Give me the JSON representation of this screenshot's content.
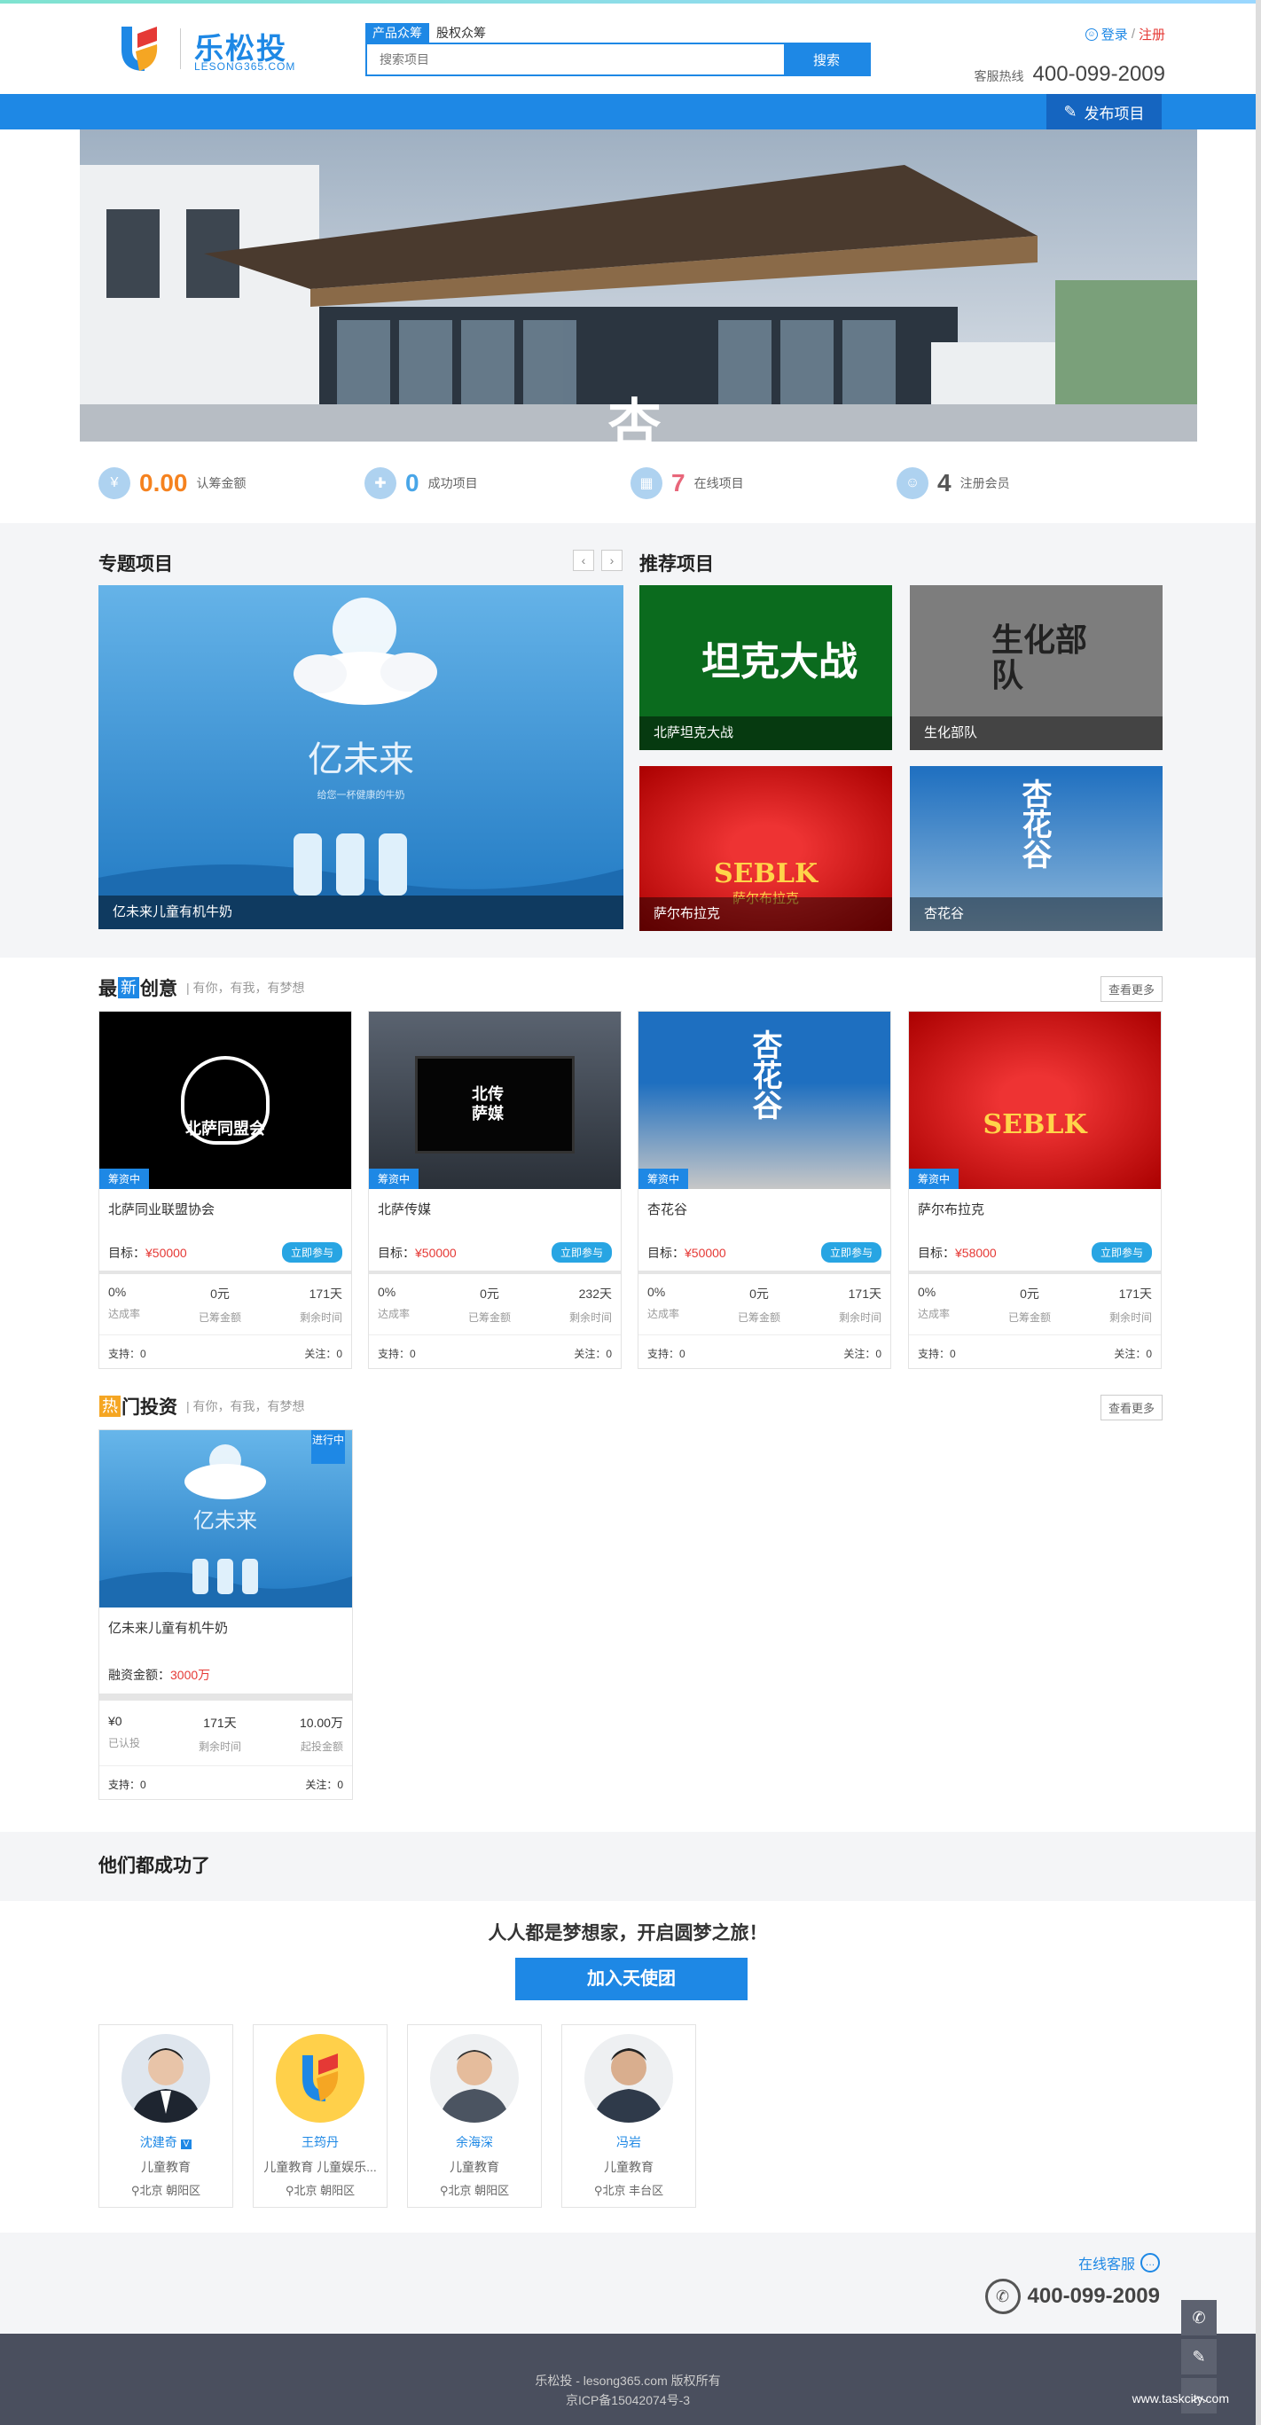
{
  "header": {
    "logo_cn": "乐松投",
    "logo_en": "LESONG365.COM",
    "search_tabs": [
      "产品众筹",
      "股权众筹"
    ],
    "search_placeholder": "搜索项目",
    "search_button": "搜索",
    "login": "登录",
    "divider": "/",
    "register": "注册",
    "hotline_label": "客服热线",
    "hotline_number": "400-099-2009"
  },
  "nav": {
    "publish": "发布项目"
  },
  "banner": {
    "title_art": "杏花谷"
  },
  "stats": [
    {
      "icon": "money-icon",
      "value": "0.00",
      "label": "认筹金额",
      "color": "#f5821f"
    },
    {
      "icon": "success-icon",
      "value": "0",
      "label": "成功项目",
      "color": "#49a6e8"
    },
    {
      "icon": "online-icon",
      "value": "7",
      "label": "在线项目",
      "color": "#e8667a"
    },
    {
      "icon": "member-icon",
      "value": "4",
      "label": "注册会员",
      "color": "#555555"
    }
  ],
  "featured": {
    "left_title": "专题项目",
    "right_title": "推荐项目",
    "big": {
      "caption": "亿未来儿童有机牛奶",
      "art_title": "亿未来",
      "art_sub": "给您一杯健康的牛奶"
    },
    "tiles": [
      {
        "caption": "北萨坦克大战",
        "art": "坦克大战"
      },
      {
        "caption": "生化部队",
        "art": "生化部队"
      },
      {
        "caption": "萨尔布拉克",
        "art": "SEBLK"
      },
      {
        "caption": "杏花谷",
        "art": "杏花谷"
      }
    ],
    "tile_sub": "萨尔布拉克"
  },
  "newest": {
    "title_pre": "最",
    "title_hl": "新",
    "title_post": "创意",
    "subtitle": "| 有你，有我，有梦想",
    "more": "查看更多",
    "cards": [
      {
        "badge": "筹资中",
        "name": "北萨同业联盟协会",
        "goal_label": "目标：",
        "goal": "¥50000",
        "join": "立即参与",
        "rate": "0%",
        "rate_l": "达成率",
        "raised": "0元",
        "raised_l": "已筹金额",
        "days": "171天",
        "days_l": "剩余时间",
        "support": "支持：0",
        "follow": "关注：0",
        "art": "北萨同盟会"
      },
      {
        "badge": "筹资中",
        "name": "北萨传媒",
        "goal_label": "目标：",
        "goal": "¥50000",
        "join": "立即参与",
        "rate": "0%",
        "rate_l": "达成率",
        "raised": "0元",
        "raised_l": "已筹金额",
        "days": "232天",
        "days_l": "剩余时间",
        "support": "支持：0",
        "follow": "关注：0",
        "art": "北传萨媒"
      },
      {
        "badge": "筹资中",
        "name": "杏花谷",
        "goal_label": "目标：",
        "goal": "¥50000",
        "join": "立即参与",
        "rate": "0%",
        "rate_l": "达成率",
        "raised": "0元",
        "raised_l": "已筹金额",
        "days": "171天",
        "days_l": "剩余时间",
        "support": "支持：0",
        "follow": "关注：0",
        "art": "杏花谷"
      },
      {
        "badge": "筹资中",
        "name": "萨尔布拉克",
        "goal_label": "目标：",
        "goal": "¥58000",
        "join": "立即参与",
        "rate": "0%",
        "rate_l": "达成率",
        "raised": "0元",
        "raised_l": "已筹金额",
        "days": "171天",
        "days_l": "剩余时间",
        "support": "支持：0",
        "follow": "关注：0",
        "art": "SEBLK"
      }
    ]
  },
  "hot": {
    "title_hl": "热",
    "title_post": "门投资",
    "subtitle": "| 有你，有我，有梦想",
    "more": "查看更多",
    "card": {
      "tag": "进行中",
      "name": "亿未来儿童有机牛奶",
      "amount_label": "融资金额：",
      "amount": "3000万",
      "a": "¥0",
      "a_l": "已认投",
      "b": "171天",
      "b_l": "剩余时间",
      "c": "10.00万",
      "c_l": "起投金额",
      "support": "支持：0",
      "follow": "关注：0",
      "art": "亿未来"
    }
  },
  "success": {
    "title": "他们都成功了",
    "slogan": "人人都是梦想家，开启圆梦之旅！",
    "join_button": "加入天使团",
    "people": [
      {
        "name": "沈建奇",
        "desc": "儿童教育",
        "loc": "北京 朝阳区",
        "verified": true
      },
      {
        "name": "王筠丹",
        "desc": "儿童教育 儿童娱乐...",
        "loc": "北京 朝阳区",
        "verified": false
      },
      {
        "name": "余海深",
        "desc": "儿童教育",
        "loc": "北京 朝阳区",
        "verified": false
      },
      {
        "name": "冯岩",
        "desc": "儿童教育",
        "loc": "北京 丰台区",
        "verified": false
      }
    ]
  },
  "contact": {
    "online_service": "在线客服",
    "phone": "400-099-2009"
  },
  "footer": {
    "line1": "乐松投 - lesong365.com 版权所有",
    "line2": "京ICP备15042074号-3",
    "watermark": "www.taskcity.com"
  }
}
